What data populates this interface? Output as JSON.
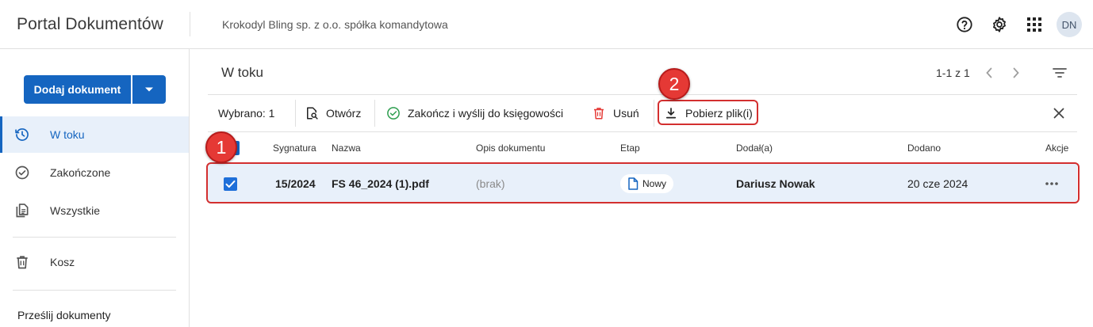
{
  "header": {
    "app_title": "Portal Dokumentów",
    "company": "Krokodyl Bling sp. z o.o. spółka komandytowa",
    "avatar_initials": "DN",
    "icons": [
      "help-circle-icon",
      "gear-icon",
      "apps-grid-icon"
    ]
  },
  "sidebar": {
    "add_button_label": "Dodaj dokument",
    "items": [
      {
        "label": "W toku",
        "icon": "clock-icon",
        "active": true
      },
      {
        "label": "Zakończone",
        "icon": "check-circle-icon",
        "active": false
      },
      {
        "label": "Wszystkie",
        "icon": "documents-icon",
        "active": false
      },
      {
        "label": "Kosz",
        "icon": "trash-icon",
        "active": false
      }
    ],
    "upload_section_title": "Prześlij dokumenty"
  },
  "main": {
    "title": "W toku",
    "pager": "1-1 z 1",
    "toolbar": {
      "selected": "Wybrano: 1",
      "open": "Otwórz",
      "finish_send": "Zakończ i wyślij do księgowości",
      "delete": "Usuń",
      "download": "Pobierz plik(i)"
    },
    "columns": [
      "Sygnatura",
      "Nazwa",
      "Opis dokumentu",
      "Etap",
      "Dodał(a)",
      "Dodano",
      "Akcje"
    ],
    "rows": [
      {
        "signature": "15/2024",
        "name": "FS 46_2024 (1).pdf",
        "description": "(brak)",
        "stage": "Nowy",
        "added_by": "Dariusz Nowak",
        "added_on": "20 cze 2024",
        "selected": true
      }
    ]
  },
  "annotations": {
    "callout_1": "1",
    "callout_2": "2"
  },
  "colors": {
    "primary": "#1565c0",
    "selected_row": "#e8f0fa",
    "annotation_red": "#d32f2f",
    "success_green": "#2e9e4f",
    "danger_red": "#e53935"
  }
}
